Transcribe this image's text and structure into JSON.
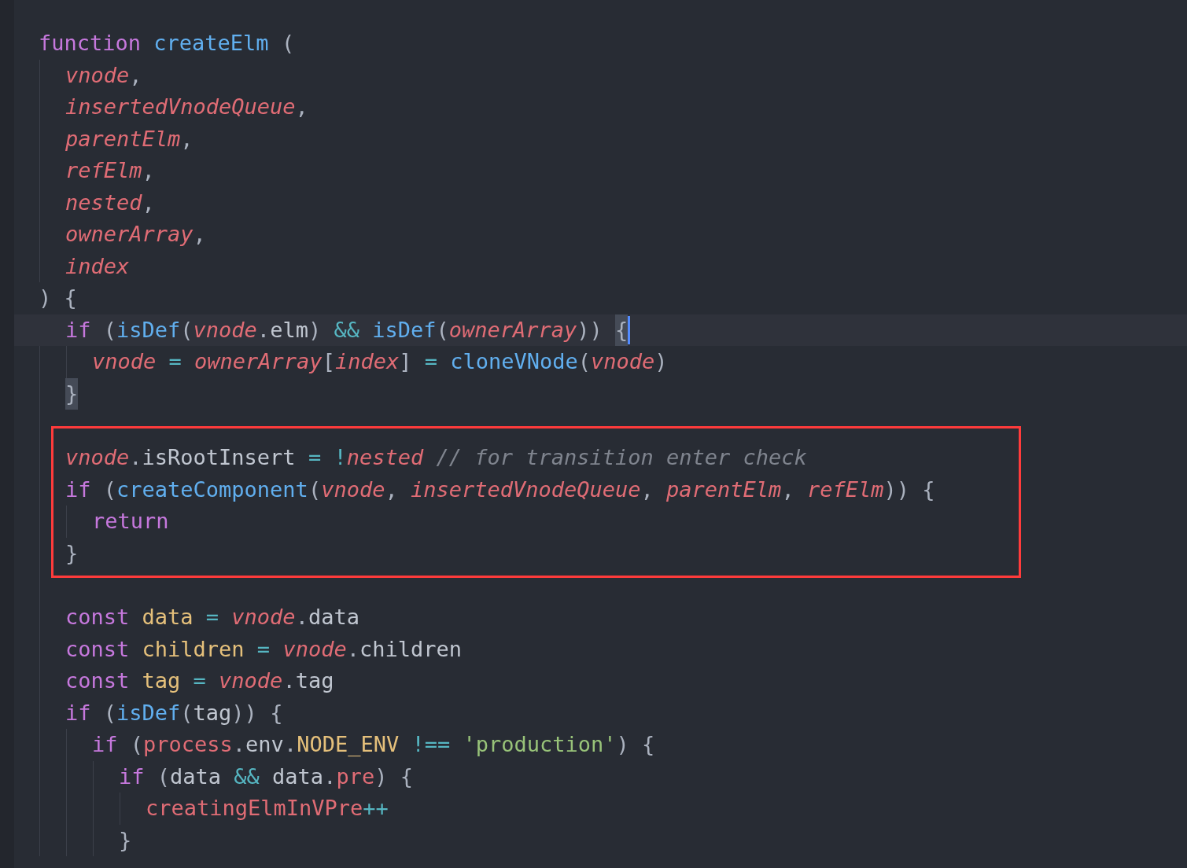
{
  "editor": {
    "lines": [
      {
        "kind": "line",
        "tokens": [
          {
            "text": "function ",
            "kind": "keyword"
          },
          {
            "text": "createElm",
            "kind": "function"
          },
          {
            "text": " (",
            "kind": "plain"
          }
        ],
        "children": [
          {
            "kind": "line",
            "tokens": [
              {
                "text": "vnode",
                "kind": "param"
              },
              {
                "text": ",",
                "kind": "plain"
              }
            ]
          },
          {
            "kind": "line",
            "tokens": [
              {
                "text": "insertedVnodeQueue",
                "kind": "param"
              },
              {
                "text": ",",
                "kind": "plain"
              }
            ]
          },
          {
            "kind": "line",
            "tokens": [
              {
                "text": "parentElm",
                "kind": "param"
              },
              {
                "text": ",",
                "kind": "plain"
              }
            ]
          },
          {
            "kind": "line",
            "tokens": [
              {
                "text": "refElm",
                "kind": "param"
              },
              {
                "text": ",",
                "kind": "plain"
              }
            ]
          },
          {
            "kind": "line",
            "tokens": [
              {
                "text": "nested",
                "kind": "param"
              },
              {
                "text": ",",
                "kind": "plain"
              }
            ]
          },
          {
            "kind": "line",
            "tokens": [
              {
                "text": "ownerArray",
                "kind": "param"
              },
              {
                "text": ",",
                "kind": "plain"
              }
            ]
          },
          {
            "kind": "line",
            "tokens": [
              {
                "text": "index",
                "kind": "param"
              }
            ]
          }
        ]
      },
      {
        "kind": "line",
        "tokens": [
          {
            "text": ") {",
            "kind": "plain"
          }
        ],
        "children": [
          {
            "kind": "active",
            "tokens": [
              {
                "text": "if",
                "kind": "keyword"
              },
              {
                "text": " (",
                "kind": "plain"
              },
              {
                "text": "isDef",
                "kind": "function"
              },
              {
                "text": "(",
                "kind": "plain"
              },
              {
                "text": "vnode",
                "kind": "param"
              },
              {
                "text": ".",
                "kind": "plain"
              },
              {
                "text": "elm",
                "kind": "property"
              },
              {
                "text": ") ",
                "kind": "plain"
              },
              {
                "text": "&& ",
                "kind": "operator"
              },
              {
                "text": "isDef",
                "kind": "function"
              },
              {
                "text": "(",
                "kind": "plain"
              },
              {
                "text": "ownerArray",
                "kind": "param"
              },
              {
                "text": ")) ",
                "kind": "plain"
              },
              {
                "text": "{",
                "kind": "match"
              }
            ],
            "children": [
              {
                "kind": "line",
                "tokens": [
                  {
                    "text": "vnode ",
                    "kind": "param"
                  },
                  {
                    "text": "= ",
                    "kind": "operator"
                  },
                  {
                    "text": "ownerArray",
                    "kind": "param"
                  },
                  {
                    "text": "[",
                    "kind": "plain"
                  },
                  {
                    "text": "index",
                    "kind": "param"
                  },
                  {
                    "text": "] ",
                    "kind": "plain"
                  },
                  {
                    "text": "= ",
                    "kind": "operator"
                  },
                  {
                    "text": "cloneVNode",
                    "kind": "function"
                  },
                  {
                    "text": "(",
                    "kind": "plain"
                  },
                  {
                    "text": "vnode",
                    "kind": "param"
                  },
                  {
                    "text": ")",
                    "kind": "plain"
                  }
                ]
              }
            ]
          },
          {
            "kind": "line",
            "tokens": [
              {
                "text": "}",
                "kind": "match"
              }
            ]
          },
          {
            "kind": "box",
            "lines": [
              {
                "kind": "line",
                "tokens": [
                  {
                    "text": "vnode",
                    "kind": "param"
                  },
                  {
                    "text": ".",
                    "kind": "plain"
                  },
                  {
                    "text": "isRootInsert ",
                    "kind": "property"
                  },
                  {
                    "text": "= !",
                    "kind": "operator"
                  },
                  {
                    "text": "nested ",
                    "kind": "param"
                  },
                  {
                    "text": "// for transition enter check",
                    "kind": "comment"
                  }
                ]
              },
              {
                "kind": "line",
                "tokens": [
                  {
                    "text": "if",
                    "kind": "keyword"
                  },
                  {
                    "text": " (",
                    "kind": "plain"
                  },
                  {
                    "text": "createComponent",
                    "kind": "function"
                  },
                  {
                    "text": "(",
                    "kind": "plain"
                  },
                  {
                    "text": "vnode",
                    "kind": "param"
                  },
                  {
                    "text": ", ",
                    "kind": "plain"
                  },
                  {
                    "text": "insertedVnodeQueue",
                    "kind": "param"
                  },
                  {
                    "text": ", ",
                    "kind": "plain"
                  },
                  {
                    "text": "parentElm",
                    "kind": "param"
                  },
                  {
                    "text": ", ",
                    "kind": "plain"
                  },
                  {
                    "text": "refElm",
                    "kind": "param"
                  },
                  {
                    "text": ")) {",
                    "kind": "plain"
                  }
                ],
                "children": [
                  {
                    "kind": "line",
                    "tokens": [
                      {
                        "text": "return",
                        "kind": "keyword"
                      }
                    ]
                  }
                ]
              },
              {
                "kind": "line",
                "tokens": [
                  {
                    "text": "}",
                    "kind": "plain"
                  }
                ]
              }
            ]
          },
          {
            "kind": "line",
            "tokens": [
              {
                "text": "const ",
                "kind": "keyword"
              },
              {
                "text": "data ",
                "kind": "variable"
              },
              {
                "text": "= ",
                "kind": "operator"
              },
              {
                "text": "vnode",
                "kind": "param"
              },
              {
                "text": ".",
                "kind": "plain"
              },
              {
                "text": "data",
                "kind": "property"
              }
            ]
          },
          {
            "kind": "line",
            "tokens": [
              {
                "text": "const ",
                "kind": "keyword"
              },
              {
                "text": "children ",
                "kind": "variable"
              },
              {
                "text": "= ",
                "kind": "operator"
              },
              {
                "text": "vnode",
                "kind": "param"
              },
              {
                "text": ".",
                "kind": "plain"
              },
              {
                "text": "children",
                "kind": "property"
              }
            ]
          },
          {
            "kind": "line",
            "tokens": [
              {
                "text": "const ",
                "kind": "keyword"
              },
              {
                "text": "tag ",
                "kind": "variable"
              },
              {
                "text": "= ",
                "kind": "operator"
              },
              {
                "text": "vnode",
                "kind": "param"
              },
              {
                "text": ".",
                "kind": "plain"
              },
              {
                "text": "tag",
                "kind": "property"
              }
            ]
          },
          {
            "kind": "line",
            "tokens": [
              {
                "text": "if",
                "kind": "keyword"
              },
              {
                "text": " (",
                "kind": "plain"
              },
              {
                "text": "isDef",
                "kind": "function"
              },
              {
                "text": "(",
                "kind": "plain"
              },
              {
                "text": "tag",
                "kind": "property"
              },
              {
                "text": ")) {",
                "kind": "plain"
              }
            ],
            "children": [
              {
                "kind": "line",
                "tokens": [
                  {
                    "text": "if",
                    "kind": "keyword"
                  },
                  {
                    "text": " (",
                    "kind": "plain"
                  },
                  {
                    "text": "process",
                    "kind": "global"
                  },
                  {
                    "text": ".",
                    "kind": "plain"
                  },
                  {
                    "text": "env",
                    "kind": "property"
                  },
                  {
                    "text": ".",
                    "kind": "plain"
                  },
                  {
                    "text": "NODE_ENV ",
                    "kind": "variable"
                  },
                  {
                    "text": "!== ",
                    "kind": "operator"
                  },
                  {
                    "text": "'production'",
                    "kind": "string"
                  },
                  {
                    "text": ") {",
                    "kind": "plain"
                  }
                ],
                "children": [
                  {
                    "kind": "line",
                    "tokens": [
                      {
                        "text": "if",
                        "kind": "keyword"
                      },
                      {
                        "text": " (",
                        "kind": "plain"
                      },
                      {
                        "text": "data ",
                        "kind": "property"
                      },
                      {
                        "text": "&& ",
                        "kind": "operator"
                      },
                      {
                        "text": "data",
                        "kind": "property"
                      },
                      {
                        "text": ".",
                        "kind": "plain"
                      },
                      {
                        "text": "pre",
                        "kind": "global"
                      },
                      {
                        "text": ") {",
                        "kind": "plain"
                      }
                    ],
                    "children": [
                      {
                        "kind": "line",
                        "tokens": [
                          {
                            "text": "creatingElmInVPre",
                            "kind": "global"
                          },
                          {
                            "text": "++",
                            "kind": "operator"
                          }
                        ]
                      }
                    ]
                  },
                  {
                    "kind": "line",
                    "tokens": [
                      {
                        "text": "}",
                        "kind": "plain"
                      }
                    ]
                  }
                ]
              }
            ]
          }
        ]
      }
    ]
  }
}
